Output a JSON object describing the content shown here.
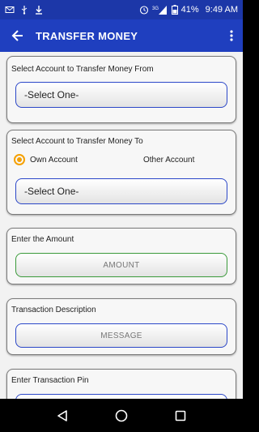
{
  "status_bar": {
    "signal": "3G",
    "battery": "41%",
    "time": "9:49 AM"
  },
  "app_bar": {
    "title": "TRANSFER MONEY"
  },
  "form": {
    "from_account": {
      "label": "Select Account to Transfer Money From",
      "value": "-Select One-"
    },
    "to_account": {
      "label": "Select Account to Transfer Money To",
      "own_account": "Own Account",
      "other_account": "Other Account",
      "selected": "Own Account",
      "value": "-Select One-"
    },
    "amount": {
      "label": "Enter the Amount",
      "placeholder": "AMOUNT"
    },
    "description": {
      "label": "Transaction Description",
      "placeholder": "MESSAGE"
    },
    "pin": {
      "label": "Enter Transaction Pin"
    }
  },
  "colors": {
    "primary": "#1f3fbf",
    "status_bar": "#1c37a8",
    "radio_accent": "#f5a000",
    "field_border_blue": "#2b47c8",
    "field_border_green": "#3a9a3a"
  }
}
